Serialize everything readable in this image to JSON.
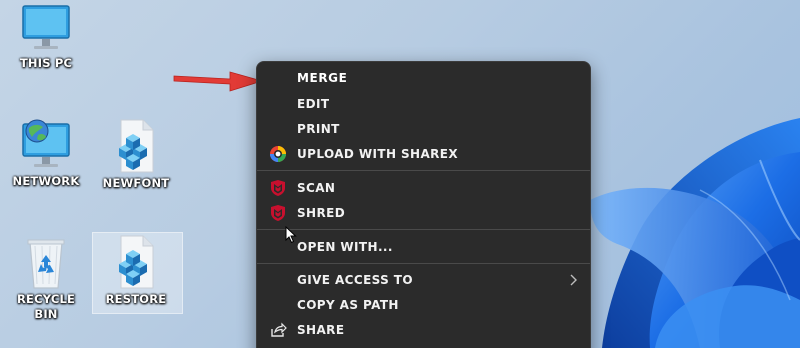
{
  "desktop": {
    "icons": [
      {
        "label": "THIS PC",
        "icon": "monitor-icon"
      },
      {
        "label": "NETWORK",
        "icon": "network-globe-icon"
      },
      {
        "label": "NEWFONT",
        "icon": "registry-file-icon"
      },
      {
        "label": "RECYCLE BIN",
        "icon": "recycle-bin-icon"
      },
      {
        "label": "RESTORE",
        "icon": "registry-file-icon"
      }
    ]
  },
  "context_menu": {
    "items": [
      {
        "label": "MERGE",
        "icon": ""
      },
      {
        "label": "EDIT",
        "icon": ""
      },
      {
        "label": "PRINT",
        "icon": ""
      },
      {
        "label": "UPLOAD WITH SHAREX",
        "icon": "sharex-icon"
      },
      {
        "label": "SCAN",
        "icon": "mcafee-icon"
      },
      {
        "label": "SHRED",
        "icon": "mcafee-icon"
      },
      {
        "label": "OPEN WITH...",
        "icon": ""
      },
      {
        "label": "GIVE ACCESS TO",
        "icon": "",
        "submenu": true
      },
      {
        "label": "COPY AS PATH",
        "icon": ""
      },
      {
        "label": "SHARE",
        "icon": "share-icon"
      }
    ]
  },
  "colors": {
    "menu_bg": "#2b2b2b",
    "menu_text": "#f2f2f2",
    "arrow": "#e23b36",
    "mcafee_red": "#c8102e",
    "wallpaper_blue": "#1f6fe0"
  }
}
